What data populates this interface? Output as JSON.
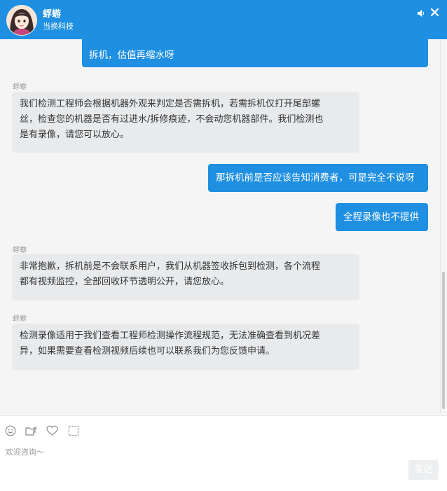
{
  "header": {
    "agent_name": "蜉蝣",
    "company": "当换科技"
  },
  "messages": [
    {
      "type": "out",
      "lines": [
        "拆机，估值再缩水呀"
      ]
    },
    {
      "type": "in",
      "sender": "蜉蝣",
      "lines": [
        "我们检测工程师会根据机器外观来判定是否需拆机，若需拆机仅打开尾部螺",
        "丝，检查您的机器是否有过进水/拆修痕迹，不会动您机器部件。我们检测也",
        "是有录像，请您可以放心。"
      ]
    },
    {
      "type": "out",
      "lines": [
        "那拆机前是否应该告知消费者，可是完全不说呀"
      ]
    },
    {
      "type": "out",
      "lines": [
        "全程录像也不提供"
      ]
    },
    {
      "type": "in",
      "sender": "蜉蝣",
      "lines": [
        "非常抱歉，拆机前是不会联系用户，我们从机器签收拆包到检测，各个流程",
        "都有视频监控，全部回收环节透明公开，请您放心。"
      ]
    },
    {
      "type": "in",
      "sender": "蜉蝣",
      "lines": [
        "检测录像适用于我们查看工程师检测操作流程规范，无法准确查看到机况差",
        "异，如果需要查看检测视频后续也可以联系我们为您反馈申请。"
      ]
    }
  ],
  "input": {
    "placeholder": "欢迎咨询～",
    "send_label": "发送"
  },
  "icons": {
    "header": [
      "sound-icon",
      "close-icon"
    ],
    "toolbar": [
      "emoji-icon",
      "upload-file-icon",
      "heart-icon",
      "screenshot-icon"
    ]
  },
  "colors": {
    "brand": "#1e8fe1",
    "incoming_bubble": "#e8eaec",
    "chat_background": "#f5f5f6"
  }
}
